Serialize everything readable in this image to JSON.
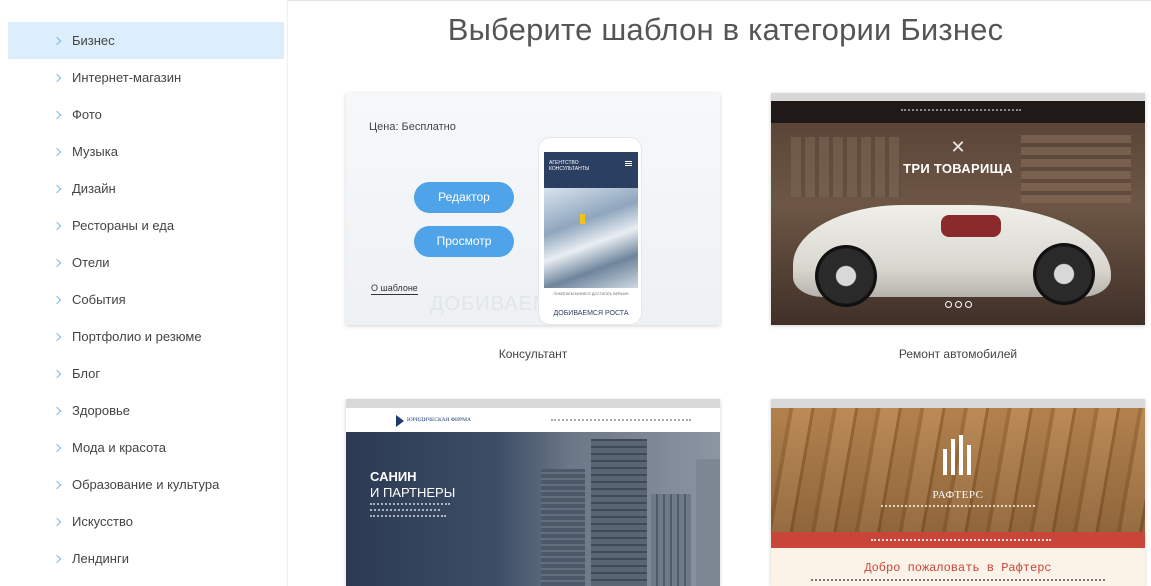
{
  "page": {
    "title": "Выберите шаблон в категории Бизнес"
  },
  "sidebar": {
    "items": [
      {
        "label": "Бизнес",
        "active": true
      },
      {
        "label": "Интернет-магазин"
      },
      {
        "label": "Фото"
      },
      {
        "label": "Музыка"
      },
      {
        "label": "Дизайн"
      },
      {
        "label": "Рестораны и еда"
      },
      {
        "label": "Отели"
      },
      {
        "label": "События"
      },
      {
        "label": "Портфолио и резюме"
      },
      {
        "label": "Блог"
      },
      {
        "label": "Здоровье"
      },
      {
        "label": "Мода и красота"
      },
      {
        "label": "Образование и культура"
      },
      {
        "label": "Искусство"
      },
      {
        "label": "Лендинги"
      }
    ]
  },
  "templates": [
    {
      "name": "Консультант",
      "price": "Цена: Бесплатно",
      "editor_label": "Редактор",
      "preview_label": "Просмотр",
      "about_label": "О шаблоне",
      "mobile_header": "АГЕНТСТВО КОНСУЛЬТАНТЫ",
      "mobile_small": "ПОМОГАЕМ БИЗНЕСУ ДОСТИГАТЬ ВЕРШИН",
      "mobile_headline": "ДОБИВАЕМСЯ РОСТА",
      "ghost_text": "ДОБИВАЕМСЯ"
    },
    {
      "name": "Ремонт автомобилей",
      "brand": "ТРИ ТОВАРИЩА",
      "logo_icon": "crossed-wrenches-icon"
    },
    {
      "name": "",
      "firm": "ЮРИДИЧЕСКАЯ ФИРМА",
      "headline_1": "САНИН",
      "headline_2": "И ПАРТНЕРЫ"
    },
    {
      "name": "",
      "brand": "РАФТЕРС",
      "welcome": "Добро пожаловать в Рафтерс"
    }
  ],
  "colors": {
    "accent": "#4fa3e8",
    "active_bg": "#dcedfb",
    "chevron": "#7cb8e8"
  }
}
